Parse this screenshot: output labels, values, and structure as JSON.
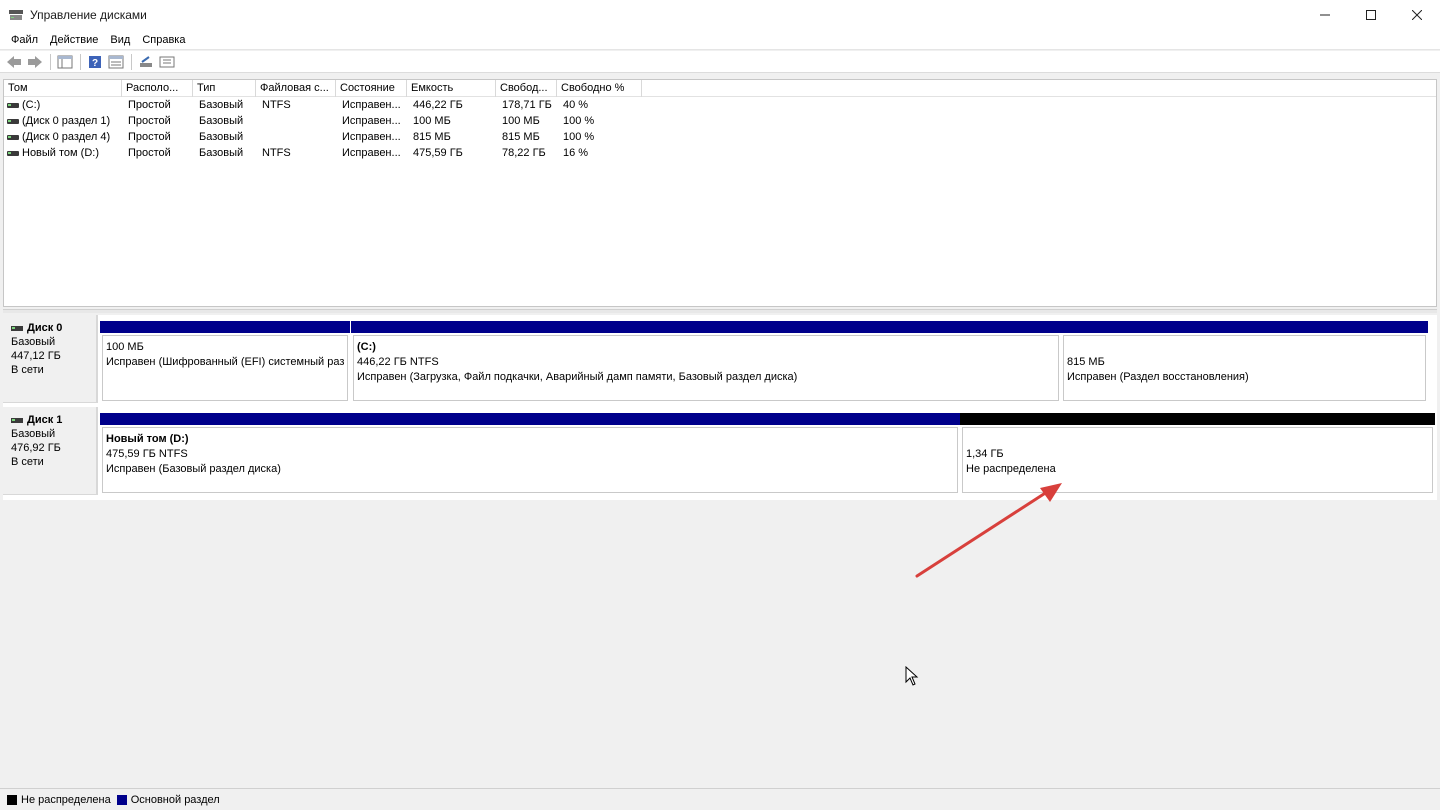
{
  "window": {
    "title": "Управление дисками"
  },
  "menu": [
    "Файл",
    "Действие",
    "Вид",
    "Справка"
  ],
  "toolbar": {
    "buttons": [
      "back-icon",
      "forward-icon",
      "console-tree-icon",
      "help-icon",
      "properties-icon",
      "rescan-icon",
      "settings-icon"
    ]
  },
  "volume_list": {
    "columns": [
      "Том",
      "Располо...",
      "Тип",
      "Файловая с...",
      "Состояние",
      "Емкость",
      "Свобод...",
      "Свободно %"
    ],
    "rows": [
      [
        "(C:)",
        "Простой",
        "Базовый",
        "NTFS",
        "Исправен...",
        "446,22 ГБ",
        "178,71 ГБ",
        "40 %"
      ],
      [
        "(Диск 0 раздел 1)",
        "Простой",
        "Базовый",
        "",
        "Исправен...",
        "100 МБ",
        "100 МБ",
        "100 %"
      ],
      [
        "(Диск 0 раздел 4)",
        "Простой",
        "Базовый",
        "",
        "Исправен...",
        "815 МБ",
        "815 МБ",
        "100 %"
      ],
      [
        "Новый том (D:)",
        "Простой",
        "Базовый",
        "NTFS",
        "Исправен...",
        "475,59 ГБ",
        "78,22 ГБ",
        "16 %"
      ]
    ]
  },
  "disks": [
    {
      "name": "Диск 0",
      "type": "Базовый",
      "size": "447,12 ГБ",
      "status": "В сети",
      "partitions": [
        {
          "title": "",
          "size": "100 МБ",
          "status": "Исправен (Шифрованный (EFI) системный раз",
          "kind": "primary"
        },
        {
          "title": "(C:)",
          "size": "446,22 ГБ NTFS",
          "status": "Исправен (Загрузка, Файл подкачки, Аварийный дамп памяти, Базовый раздел диска)",
          "kind": "primary"
        },
        {
          "title": "",
          "size": "815 МБ",
          "status": "Исправен (Раздел восстановления)",
          "kind": "primary"
        }
      ]
    },
    {
      "name": "Диск 1",
      "type": "Базовый",
      "size": "476,92 ГБ",
      "status": "В сети",
      "partitions": [
        {
          "title": "Новый том  (D:)",
          "size": "475,59 ГБ NTFS",
          "status": "Исправен (Базовый раздел диска)",
          "kind": "primary"
        },
        {
          "title": "",
          "size": "1,34 ГБ",
          "status": "Не распределена",
          "kind": "unallocated"
        }
      ]
    }
  ],
  "legend": [
    {
      "label": "Не распределена",
      "color": "#000000"
    },
    {
      "label": "Основной раздел",
      "color": "#00008b"
    }
  ],
  "colors": {
    "primary": "#00008b",
    "unallocated": "#000000",
    "annotation_arrow": "#d8403c"
  }
}
